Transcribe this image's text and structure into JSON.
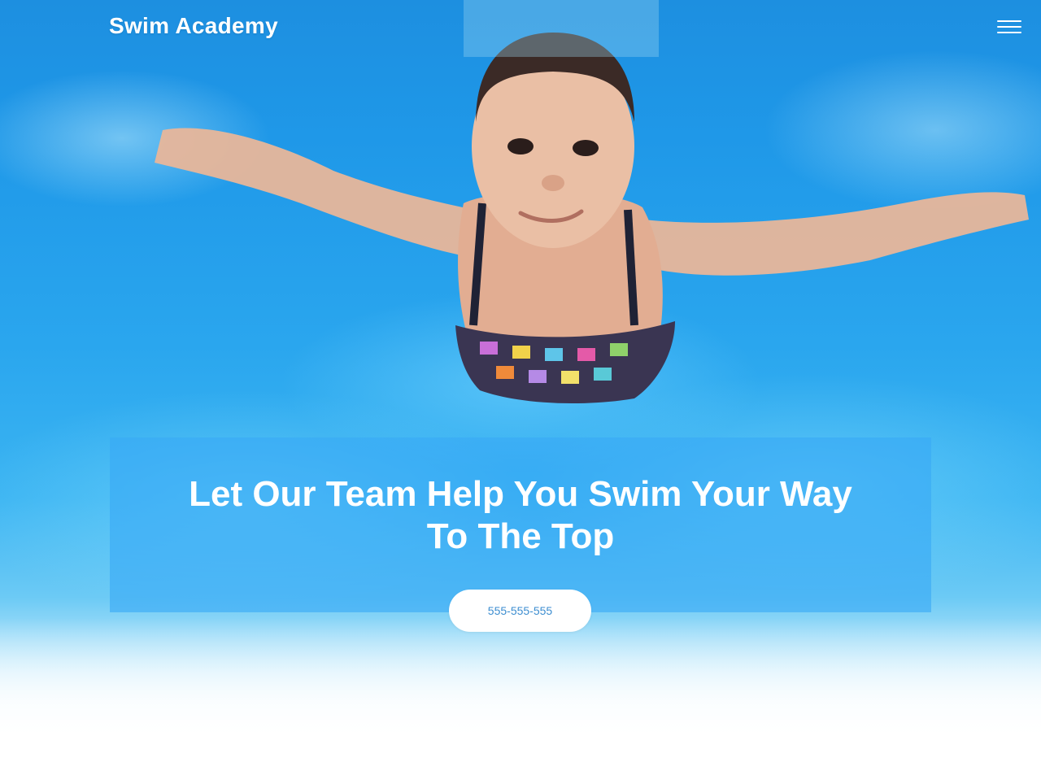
{
  "header": {
    "brand": "Swim Academy",
    "menu_icon": "hamburger-menu-icon"
  },
  "hero": {
    "headline": "Let Our Team Help You Swim Your Way To The Top",
    "phone_button": "555-555-555",
    "image": "underwater-swimming-girl-photo"
  },
  "colors": {
    "water": "#2aa6ee",
    "overlay": "#38aaf5",
    "button_text": "#3d8ed0",
    "white": "#ffffff"
  }
}
